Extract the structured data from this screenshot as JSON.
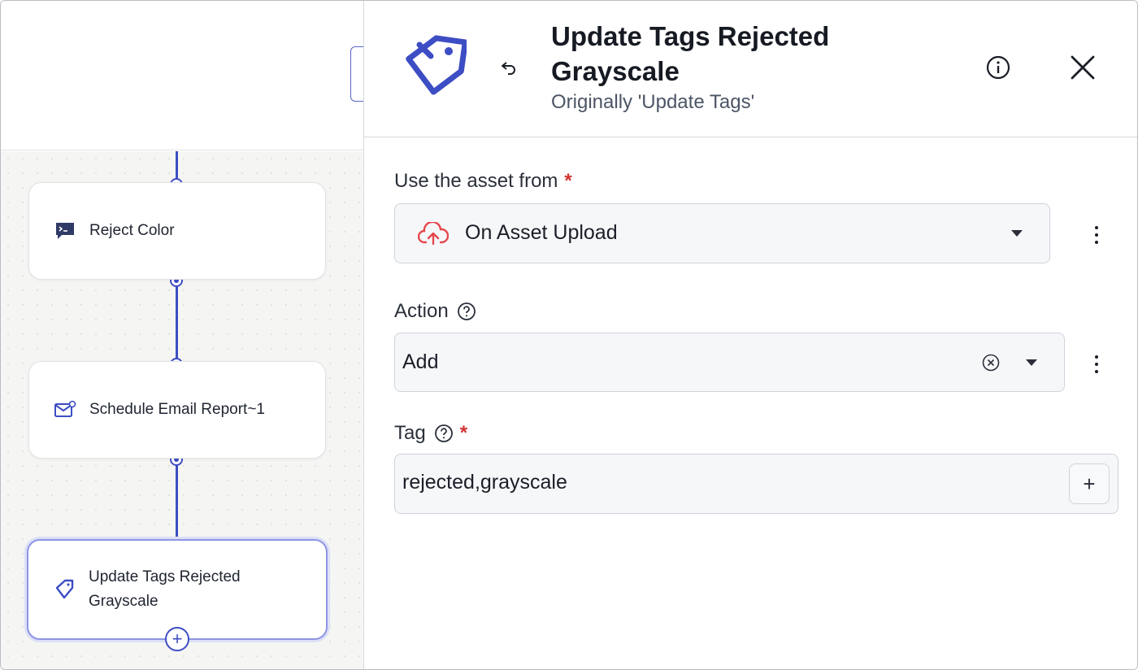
{
  "workflow": {
    "nodes": [
      {
        "label": "Reject Color",
        "icon": "terminal-icon"
      },
      {
        "label": "Schedule Email Report~1",
        "icon": "email-schedule-icon"
      },
      {
        "label": "Update Tags Rejected Grayscale",
        "icon": "tag-icon",
        "selected": true
      }
    ]
  },
  "panel": {
    "title": "Update Tags Rejected Grayscale",
    "subtitle": "Originally 'Update Tags'",
    "icons": {
      "header": "tag-icon",
      "undo": "undo-icon",
      "info": "info-icon",
      "close": "close-icon"
    },
    "fields": {
      "asset": {
        "label": "Use the asset from",
        "required": "*",
        "value": "On Asset Upload",
        "icon": "cloud-upload-icon"
      },
      "action": {
        "label": "Action",
        "value": "Add"
      },
      "tag": {
        "label": "Tag",
        "required": "*",
        "value": "rejected,grayscale",
        "add_label": "+"
      }
    }
  },
  "colors": {
    "accent": "#3d4dc4",
    "required": "#d23232",
    "upload_icon": "#e5474c"
  }
}
